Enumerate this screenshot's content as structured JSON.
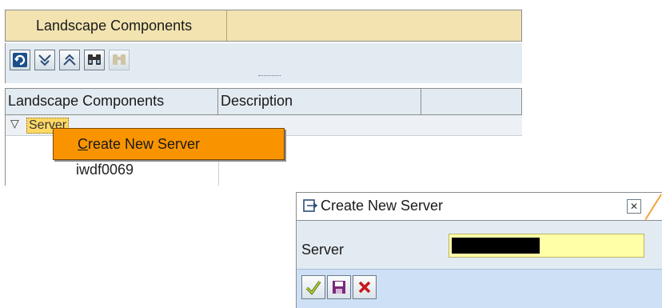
{
  "panel": {
    "title": "Landscape Components",
    "toolbar": {
      "buttons": [
        {
          "icon": "refresh-icon",
          "enabled": true
        },
        {
          "icon": "expand-icon",
          "enabled": true
        },
        {
          "icon": "collapse-icon",
          "enabled": true
        },
        {
          "icon": "find-icon",
          "enabled": true
        },
        {
          "icon": "find-next-icon",
          "enabled": false
        }
      ]
    },
    "table": {
      "columns": [
        "Landscape Components",
        "Description",
        ""
      ],
      "rows": [
        {
          "label": "Server",
          "expanded": true
        },
        {
          "label": "iwdf0069"
        }
      ]
    },
    "context_menu": {
      "items": [
        "Create New Server"
      ]
    }
  },
  "dialog": {
    "title": "Create New Server",
    "field_label": "Server",
    "field_value": "",
    "buttons": [
      "confirm-check-icon",
      "save-icon",
      "cancel-x-icon"
    ]
  },
  "colors": {
    "title_bar": "#f2e3b0",
    "toolbar_bg": "#e3ebf2",
    "menu_highlight": "#f99400",
    "input_bg": "#ffffa8",
    "dialog_toolbar": "#cde0f6"
  }
}
